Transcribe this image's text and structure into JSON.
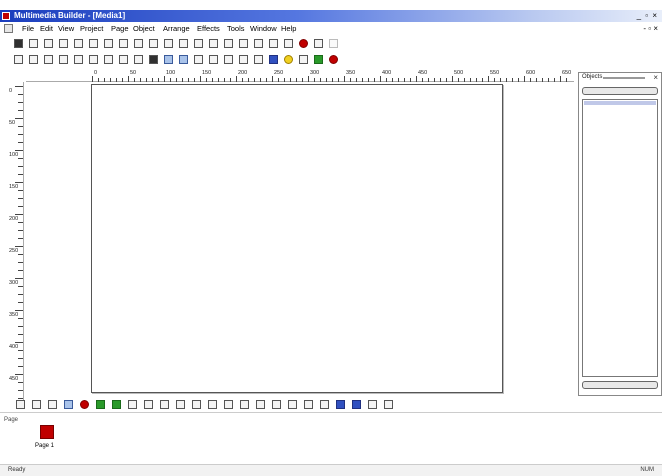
{
  "titlebar": {
    "title": "Multimedia Builder - [Media1]",
    "window_buttons": "_ ▫ ×"
  },
  "menubar": {
    "items": [
      "File",
      "Edit",
      "View",
      "Project",
      "Page",
      "Object",
      "Arrange",
      "Effects",
      "Tools",
      "Window",
      "Help"
    ],
    "doc_buttons": "- ▫ ×"
  },
  "toolbars": {
    "row1_icons": [
      "select-arrow-icon",
      "text-icon",
      "text-box-icon",
      "button-icon",
      "image-icon",
      "bitmap-button-icon",
      "sound-icon",
      "menu-icon",
      "video-icon",
      "flash-icon",
      "rectangle-icon",
      "rounded-rectangle-icon",
      "ellipse-icon",
      "line-icon",
      "polyline-icon",
      "frame-icon",
      "bitmap-icon",
      "paragraph-icon",
      "globe-icon",
      "html-icon",
      "mpeg-icon",
      "ani-icon"
    ],
    "row2_icons": [
      "new-icon",
      "open-icon",
      "open-folder-icon",
      "save-icon",
      "cut-icon",
      "copy-icon",
      "paste-icon",
      "undo-icon",
      "redo-icon",
      "binoculars-icon",
      "grid-icon",
      "snap-icon",
      "page-properties-icon",
      "insert-page-icon",
      "delete-page-icon",
      "align-icon",
      "cursor-icon",
      "line-color-icon",
      "fill-color-icon",
      "text-color-icon",
      "effects-icon",
      "record-icon"
    ]
  },
  "rulers": {
    "horizontal_labels": [
      "0",
      "50",
      "100",
      "150",
      "200",
      "250",
      "300",
      "350",
      "400",
      "450",
      "500",
      "550",
      "600",
      "650",
      "700"
    ],
    "vertical_labels": [
      "0",
      "50",
      "100",
      "150",
      "200",
      "250",
      "300",
      "350",
      "400",
      "450"
    ]
  },
  "objects_panel": {
    "title": "Objects",
    "close": "×"
  },
  "bottom_toolbar": {
    "icons": [
      "new-page-icon",
      "page-icon",
      "master-page-icon",
      "page-list-icon",
      "delete-icon",
      "back-arrow-icon",
      "forward-arrow-icon",
      "check-script-icon",
      "edit-script-icon",
      "align-left-icon",
      "align-center-icon",
      "align-right-icon",
      "align-top-icon",
      "align-middle-icon",
      "align-bottom-icon",
      "space-horizontal-icon",
      "space-vertical-icon",
      "same-width-icon",
      "same-height-icon",
      "same-size-icon",
      "group-icon",
      "ungroup-icon",
      "front-icon",
      "back-icon"
    ]
  },
  "pages": {
    "side_label": "Page",
    "items": [
      {
        "label": "Page 1",
        "color": "#c00000"
      }
    ]
  },
  "statusbar": {
    "left": "Ready",
    "right": "NUM"
  },
  "colors": {
    "titlebar_start": "#1a3dbd",
    "page_thumb": "#c00000",
    "selection": "#a9c3ea"
  }
}
